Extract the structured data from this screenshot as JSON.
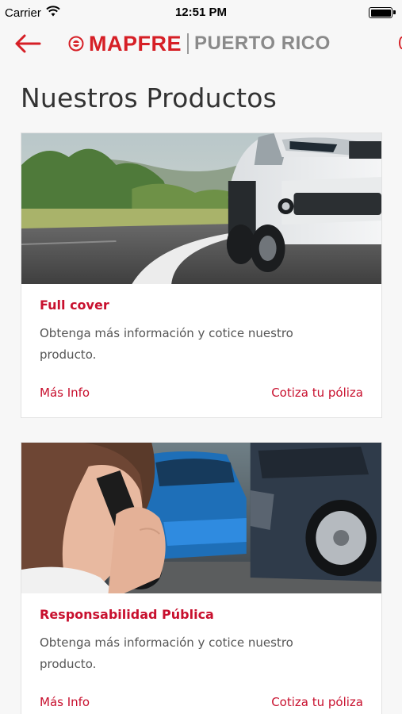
{
  "status_bar": {
    "carrier": "Carrier",
    "time": "12:51 PM"
  },
  "header": {
    "brand": "MAPFRE",
    "region": "PUERTO RICO",
    "accent_color": "#d61f26"
  },
  "page": {
    "title": "Nuestros Productos"
  },
  "products": [
    {
      "title": "Full cover",
      "description": "Obtenga más información y cotice nuestro producto.",
      "more_info": "Más Info",
      "quote": "Cotiza tu póliza",
      "image": "car-on-road-image"
    },
    {
      "title": "Responsabilidad Pública",
      "description": "Obtenga más información y cotice nuestro producto.",
      "more_info": "Más Info",
      "quote": "Cotiza tu póliza",
      "image": "woman-phone-car-accident-image"
    }
  ]
}
